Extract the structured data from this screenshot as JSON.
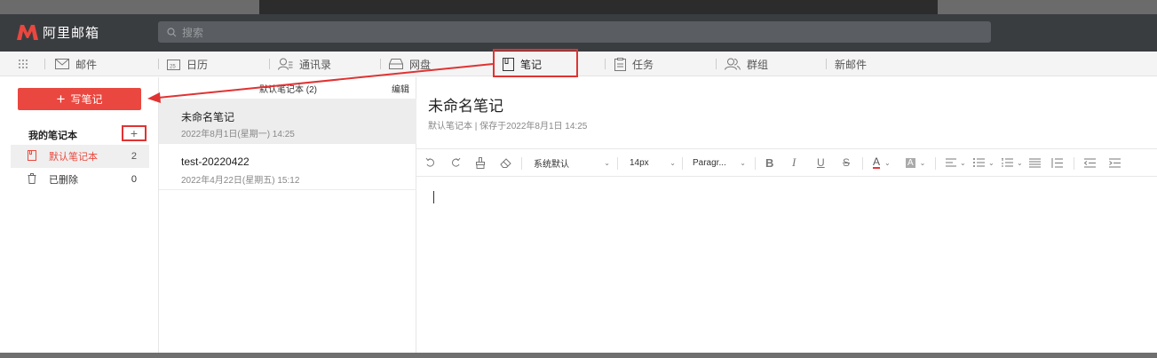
{
  "app": {
    "title": "阿里邮箱"
  },
  "search": {
    "placeholder": "搜索"
  },
  "nav": {
    "items": [
      {
        "label": "邮件",
        "icon": "mail-icon"
      },
      {
        "label": "日历",
        "icon": "calendar-icon",
        "icon_text": "25"
      },
      {
        "label": "通讯录",
        "icon": "contacts-icon"
      },
      {
        "label": "网盘",
        "icon": "drive-icon"
      },
      {
        "label": "笔记",
        "icon": "notebook-icon"
      },
      {
        "label": "任务",
        "icon": "task-icon"
      },
      {
        "label": "群组",
        "icon": "group-icon"
      },
      {
        "label": "新邮件",
        "icon": ""
      }
    ],
    "active": "笔记"
  },
  "sidebar": {
    "write_button": "写笔记",
    "my_notebooks": "我的笔记本",
    "add_symbol": "+",
    "notebooks": [
      {
        "label": "默认笔记本",
        "count": "2",
        "icon": "notebook-icon"
      },
      {
        "label": "已删除",
        "count": "0",
        "icon": "trash-icon"
      }
    ]
  },
  "note_list": {
    "header": "默认笔记本 (2)",
    "edit": "编辑",
    "notes": [
      {
        "title": "未命名笔记",
        "date": "2022年8月1日(星期一) 14:25"
      },
      {
        "title": "test-20220422",
        "date": "2022年4月22日(星期五) 15:12"
      }
    ]
  },
  "editor": {
    "title": "未命名笔记",
    "meta": "默认笔记本 | 保存于2022年8月1日 14:25",
    "font_family": "系统默认",
    "font_size": "14px",
    "paragraph": "Paragr..."
  },
  "colors": {
    "accent": "#e9473f",
    "highlight": "#e03333",
    "header_bg": "#3a3d40"
  }
}
